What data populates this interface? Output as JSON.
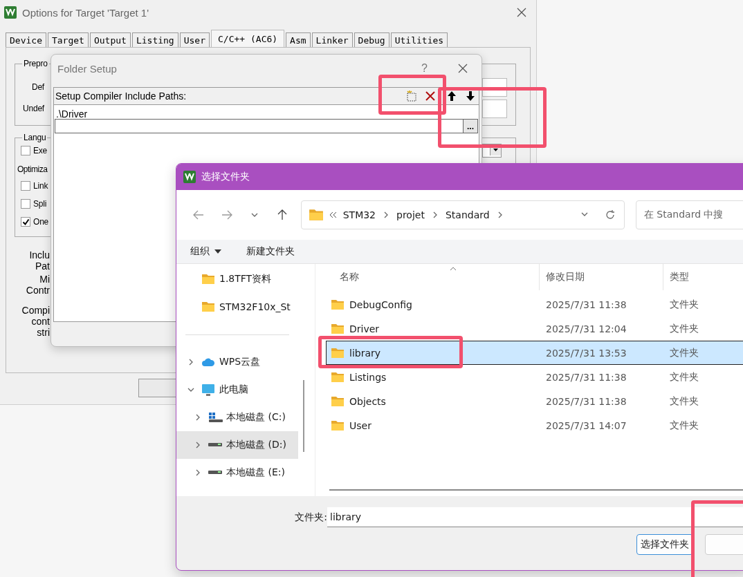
{
  "options_window": {
    "title": "Options for Target 'Target 1'",
    "tabs": [
      {
        "label": "Device",
        "selected": false
      },
      {
        "label": "Target",
        "selected": false
      },
      {
        "label": "Output",
        "selected": false
      },
      {
        "label": "Listing",
        "selected": false
      },
      {
        "label": "User",
        "selected": false
      },
      {
        "label": "C/C++ (AC6)",
        "selected": true
      },
      {
        "label": "Asm",
        "selected": false
      },
      {
        "label": "Linker",
        "selected": false
      },
      {
        "label": "Debug",
        "selected": false
      },
      {
        "label": "Utilities",
        "selected": false
      }
    ],
    "preprocessor_group": {
      "title": "Prepro",
      "labels": [
        "Def",
        "Undef"
      ]
    },
    "language_group": {
      "title": "Langu",
      "options": [
        {
          "label": "Exe",
          "checked": false
        }
      ],
      "optimization_label": "Optimiza",
      "more_options": [
        {
          "label": "Link",
          "checked": false
        },
        {
          "label": "Spli",
          "checked": false
        },
        {
          "label": "One",
          "checked": true
        }
      ]
    },
    "side_labels": [
      {
        "lines": [
          "Inclu",
          "Pat"
        ]
      },
      {
        "lines": [
          "Mi",
          "Contr"
        ]
      },
      {
        "lines": [
          "Compi",
          "cont",
          "stri"
        ]
      }
    ]
  },
  "folder_setup": {
    "title": "Folder Setup",
    "help": "?",
    "list_label": "Setup Compiler Include Paths:",
    "paths": [
      ".\\Driver"
    ],
    "browse_button": "..."
  },
  "folder_dialog": {
    "title": "选择文件夹",
    "breadcrumbs": [
      "STM32",
      "projet",
      "Standard"
    ],
    "search": {
      "placeholder": "在 Standard 中搜"
    },
    "toolbar": [
      {
        "label": "组织",
        "kind": "menu"
      },
      {
        "label": "新建文件夹",
        "kind": "button"
      }
    ],
    "sidebar": [
      {
        "label": "1.8TFT资料",
        "kind": "folder",
        "selected": false
      },
      {
        "label": "STM32F10x_St",
        "kind": "folder",
        "selected": false
      },
      {
        "kind": "divider"
      },
      {
        "label": "WPS云盘",
        "kind": "cloud",
        "expanded": false,
        "selected": false
      },
      {
        "label": "此电脑",
        "kind": "computer",
        "expanded": true,
        "selected": false,
        "children": [
          {
            "label": "本地磁盘 (C:)",
            "kind": "system-drive",
            "expanded": false,
            "selected": false
          },
          {
            "label": "本地磁盘 (D:)",
            "kind": "drive",
            "expanded": false,
            "selected": true
          },
          {
            "label": "本地磁盘 (E:)",
            "kind": "drive",
            "expanded": false,
            "selected": false
          }
        ]
      }
    ],
    "columns": [
      {
        "label": "名称",
        "sorted": true
      },
      {
        "label": "修改日期",
        "sorted": false
      },
      {
        "label": "类型",
        "sorted": false
      }
    ],
    "rows": [
      {
        "name": "DebugConfig",
        "date": "2025/7/31 11:38",
        "type": "文件夹",
        "selected": false
      },
      {
        "name": "Driver",
        "date": "2025/7/31 12:04",
        "type": "文件夹",
        "selected": false
      },
      {
        "name": "library",
        "date": "2025/7/31 13:53",
        "type": "文件夹",
        "selected": true
      },
      {
        "name": "Listings",
        "date": "2025/7/31 11:38",
        "type": "文件夹",
        "selected": false
      },
      {
        "name": "Objects",
        "date": "2025/7/31 11:38",
        "type": "文件夹",
        "selected": false
      },
      {
        "name": "User",
        "date": "2025/7/31 14:07",
        "type": "文件夹",
        "selected": false
      }
    ],
    "folder_label": "文件夹:",
    "folder_value": "library",
    "buttons": [
      "选择文件夹"
    ]
  },
  "highlight_frames": [
    {
      "kind": "frame"
    },
    {
      "kind": "frame"
    },
    {
      "kind": "frame"
    },
    {
      "kind": "frame"
    }
  ]
}
